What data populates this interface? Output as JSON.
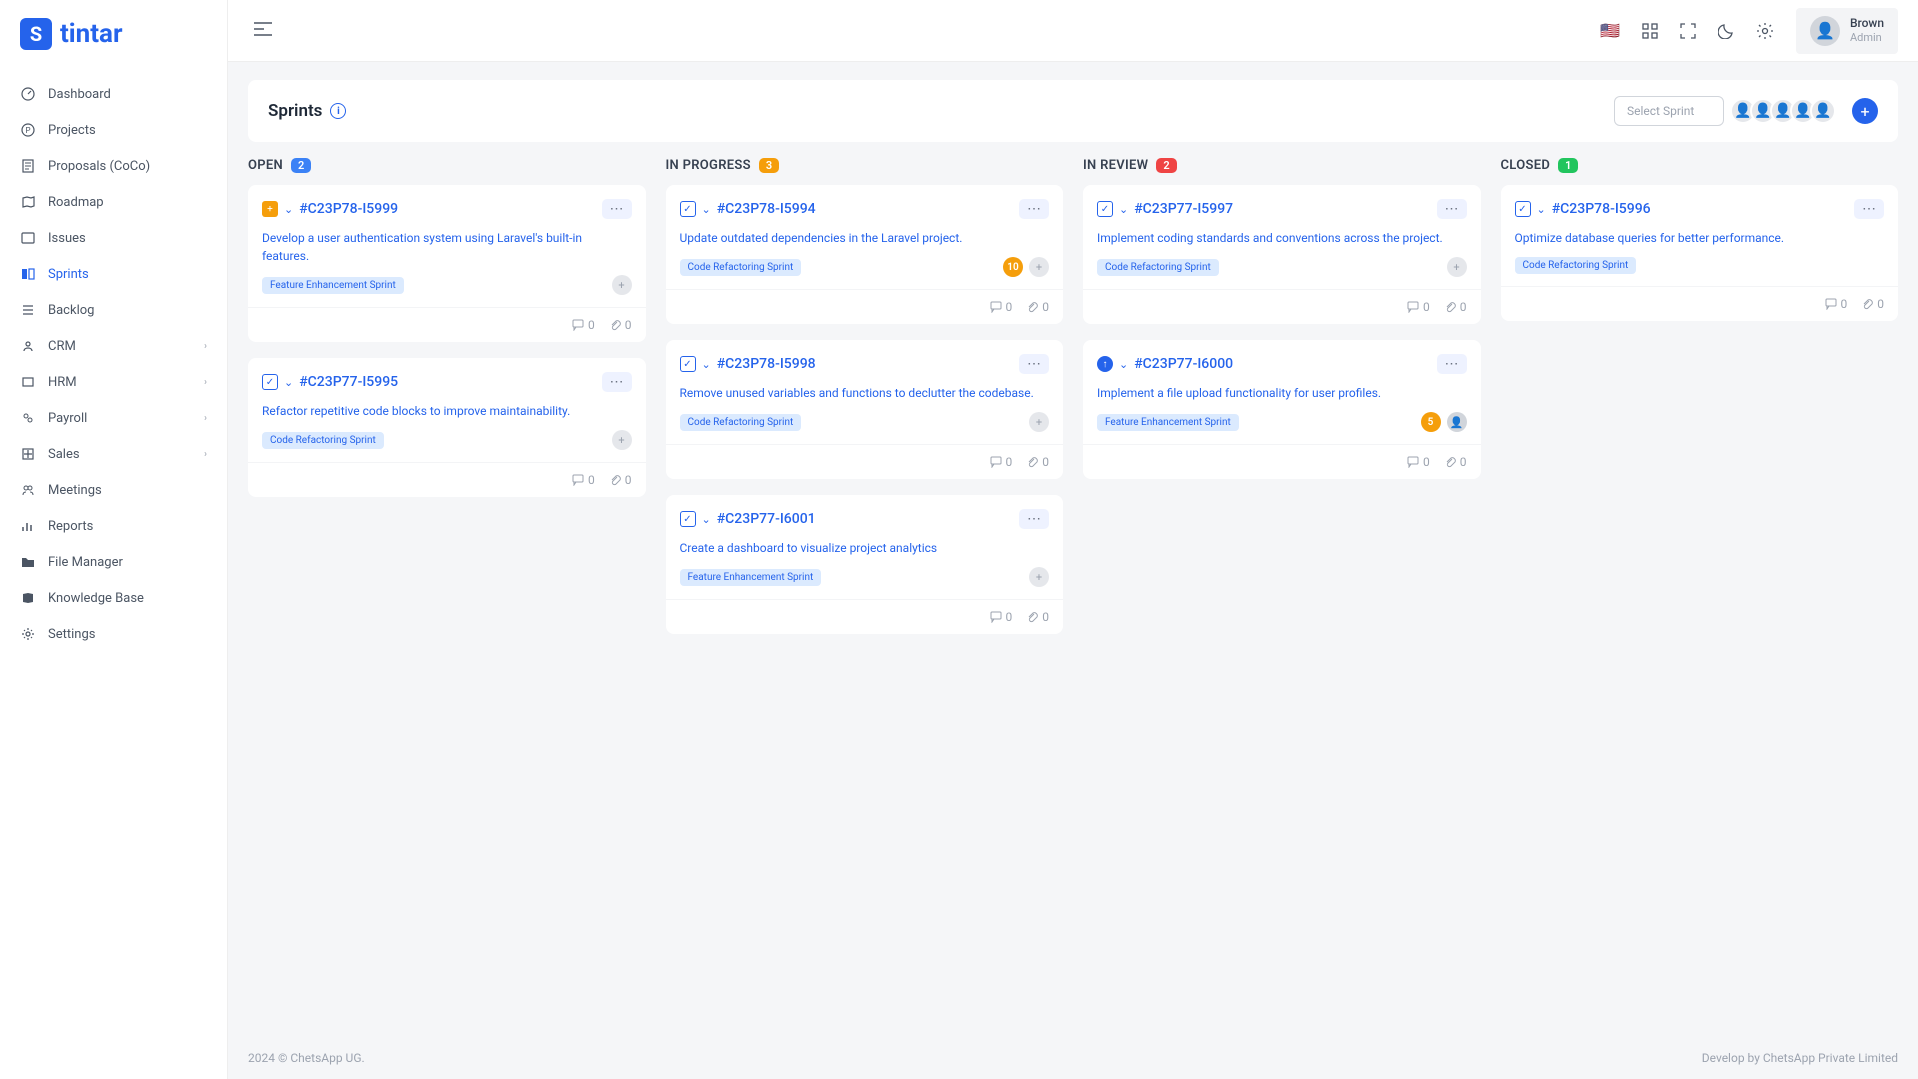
{
  "logo": {
    "text": "tintar"
  },
  "user": {
    "name": "Brown",
    "role": "Admin"
  },
  "sidebar": [
    {
      "label": "Dashboard",
      "icon": "gauge"
    },
    {
      "label": "Projects",
      "icon": "p"
    },
    {
      "label": "Proposals (CoCo)",
      "icon": "doc"
    },
    {
      "label": "Roadmap",
      "icon": "map"
    },
    {
      "label": "Issues",
      "icon": "issue"
    },
    {
      "label": "Sprints",
      "icon": "sprint",
      "active": true
    },
    {
      "label": "Backlog",
      "icon": "backlog"
    },
    {
      "label": "CRM",
      "icon": "crm",
      "chevron": true
    },
    {
      "label": "HRM",
      "icon": "hrm",
      "chevron": true
    },
    {
      "label": "Payroll",
      "icon": "payroll",
      "chevron": true
    },
    {
      "label": "Sales",
      "icon": "sales",
      "chevron": true
    },
    {
      "label": "Meetings",
      "icon": "meetings"
    },
    {
      "label": "Reports",
      "icon": "reports"
    },
    {
      "label": "File Manager",
      "icon": "files"
    },
    {
      "label": "Knowledge Base",
      "icon": "kb"
    },
    {
      "label": "Settings",
      "icon": "settings"
    }
  ],
  "page": {
    "title": "Sprints",
    "select_placeholder": "Select Sprint"
  },
  "columns": [
    {
      "title": "OPEN",
      "count": "2",
      "badge": "blue",
      "cards": [
        {
          "id": "#C23P78-I5999",
          "type": "feature",
          "desc": "Develop a user authentication system using Laravel's built-in features.",
          "tag": "Feature Enhancement Sprint",
          "comments": "0",
          "attachments": "0",
          "assignee": true
        },
        {
          "id": "#C23P77-I5995",
          "type": "task",
          "desc": "Refactor repetitive code blocks to improve maintainability.",
          "tag": "Code Refactoring Sprint",
          "comments": "0",
          "attachments": "0",
          "assignee": true
        }
      ]
    },
    {
      "title": "IN PROGRESS",
      "count": "3",
      "badge": "orange",
      "cards": [
        {
          "id": "#C23P78-I5994",
          "type": "task",
          "desc": "Update outdated dependencies in the Laravel project.",
          "tag": "Code Refactoring Sprint",
          "comments": "0",
          "attachments": "0",
          "countBadge": "10",
          "assignee": true
        },
        {
          "id": "#C23P78-I5998",
          "type": "task",
          "desc": "Remove unused variables and functions to declutter the codebase.",
          "tag": "Code Refactoring Sprint",
          "comments": "0",
          "attachments": "0",
          "assignee": true
        },
        {
          "id": "#C23P77-I6001",
          "type": "task",
          "desc": "Create a dashboard to visualize project analytics",
          "tag": "Feature Enhancement Sprint",
          "comments": "0",
          "attachments": "0",
          "assignee": true
        }
      ]
    },
    {
      "title": "IN REVIEW",
      "count": "2",
      "badge": "red",
      "cards": [
        {
          "id": "#C23P77-I5997",
          "type": "task",
          "desc": "Implement coding standards and conventions across the project.",
          "tag": "Code Refactoring Sprint",
          "comments": "0",
          "attachments": "0",
          "assignee": true
        },
        {
          "id": "#C23P77-I6000",
          "type": "up",
          "desc": "Implement a file upload functionality for user profiles.",
          "tag": "Feature Enhancement Sprint",
          "comments": "0",
          "attachments": "0",
          "countBadge": "5",
          "avatarImg": true
        }
      ]
    },
    {
      "title": "CLOSED",
      "count": "1",
      "badge": "green",
      "cards": [
        {
          "id": "#C23P78-I5996",
          "type": "task",
          "desc": "Optimize database queries for better performance.",
          "tag": "Code Refactoring Sprint",
          "comments": "0",
          "attachments": "0"
        }
      ]
    }
  ],
  "footer": {
    "left": "2024 © ChetsApp UG.",
    "right": "Develop by ChetsApp Private Limited"
  }
}
